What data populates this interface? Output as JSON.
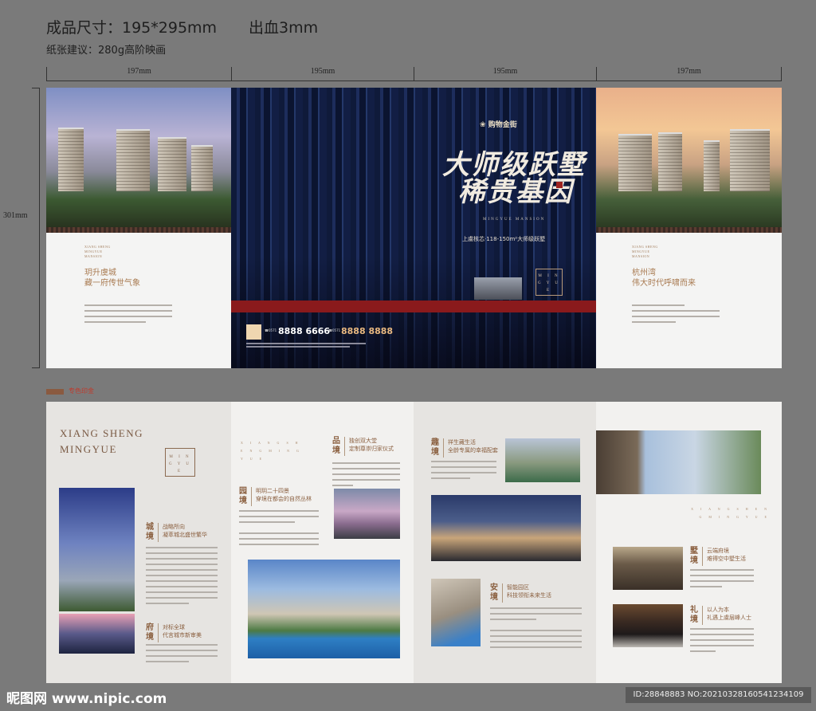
{
  "spec": {
    "finished_size": "成品尺寸：195*295mm",
    "bleed": "出血3mm",
    "paper": "纸张建议：280g高阶映画"
  },
  "rulers": {
    "widths": [
      "197mm",
      "195mm",
      "195mm",
      "197mm"
    ],
    "height": "301mm"
  },
  "outside": {
    "panel_left": {
      "tag": "XIANG SHENG MINGYUE MANSION",
      "title1": "玥升虞城",
      "title2": "藏一府传世气象"
    },
    "cover": {
      "brand": "购物金街",
      "headline1": "大师级跃墅",
      "headline2": "稀贵基因",
      "subtitle": "MINGYUE MANSION",
      "tagline": "上虞核芯·118-150m²大师级跃墅",
      "seal": "M I N G  Y U E",
      "phone_prefix1": "☎0571",
      "phone1": "8888 6666",
      "phone_prefix2": "☎0571",
      "phone2": "8888 8888"
    },
    "panel_right": {
      "tag": "XIANG SHENG MINGYUE MANSION",
      "title1": "杭州湾",
      "title2": "伟大时代呼啸而来"
    }
  },
  "spot_label": "专色印金",
  "inside": {
    "panel1": {
      "heading1": "XIANG SHENG",
      "heading2": "MINGYUE",
      "seal": "M I N G  Y U E",
      "sections": [
        {
          "tag": "城境",
          "title1": "战略所向",
          "title2": "凝萃城北盛世繁华"
        },
        {
          "tag": "府境",
          "title1": "对标全球",
          "title2": "代言城市新审美"
        }
      ]
    },
    "panel2": {
      "mini": "X I A N G  S H E N G  M I N G Y U E",
      "sections": [
        {
          "tag": "品境",
          "title1": "独创双大堂",
          "title2": "定制尊崇归家仪式"
        },
        {
          "tag": "园境",
          "title1": "明玥二十四景",
          "title2": "穿境在都会的自然丛林"
        }
      ]
    },
    "panel3": {
      "sections": [
        {
          "tag": "趣境",
          "title1": "祥生藏生活",
          "title2": "全龄专属的幸福配套"
        },
        {
          "tag": "安境",
          "title1": "智能园区",
          "title2": "科技领衔未来生活"
        }
      ]
    },
    "panel4": {
      "mini": "X I A N G  S H E N G  M I N G Y U E",
      "sections": [
        {
          "tag": "墅境",
          "title1": "云端府境",
          "title2": "难得空中墅生活"
        },
        {
          "tag": "礼境",
          "title1": "以人为本",
          "title2": "礼遇上虞层峰人士"
        }
      ]
    }
  },
  "watermark": {
    "logo": "昵图网 www.nipic.com",
    "id": "ID:28848883 NO:20210328160541234109"
  },
  "colors": {
    "gold": "#a97b52",
    "cover_blue": "#13204a",
    "red_band": "#8a1a1c",
    "spot_swatch": "#8a5a40"
  }
}
